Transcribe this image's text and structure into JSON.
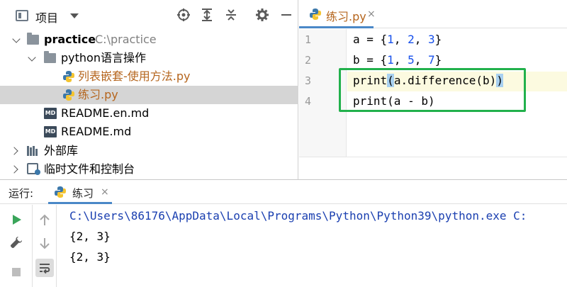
{
  "project_panel": {
    "title": "项目",
    "tree": [
      {
        "label": "practice",
        "hint": "C:\\practice"
      },
      {
        "label": "python语言操作"
      },
      {
        "label": "列表嵌套-使用方法.py"
      },
      {
        "label": "练习.py"
      },
      {
        "label": "README.en.md",
        "icon_text": "MD"
      },
      {
        "label": "README.md",
        "icon_text": "MD"
      },
      {
        "label": "外部库"
      },
      {
        "label": "临时文件和控制台"
      }
    ]
  },
  "editor": {
    "tab_label": "练习.py",
    "tab_close": "×",
    "line_numbers": [
      "1",
      "2",
      "3",
      "4"
    ],
    "code": {
      "line1": {
        "a": "a = {",
        "n1": "1",
        "s1": ", ",
        "n2": "2",
        "s2": ", ",
        "n3": "3",
        "end": "}"
      },
      "line2": {
        "a": "b = {",
        "n1": "1",
        "s1": ", ",
        "n2": "5",
        "s2": ", ",
        "n3": "7",
        "end": "}"
      },
      "line3": {
        "fn": "print",
        "open": "(",
        "body": "a.difference(b)",
        "close": ")"
      },
      "line4": {
        "text": "print(a - b)"
      }
    },
    "highlight_color": "#22b14c"
  },
  "run_panel": {
    "label": "运行:",
    "tab_label": "练习",
    "tab_close": "×",
    "console": [
      "C:\\Users\\86176\\AppData\\Local\\Programs\\Python\\Python39\\python.exe C:",
      "{2, 3}",
      "{2, 3}"
    ]
  },
  "colors": {
    "accent_tab": "#4a88c7",
    "number": "#1750eb",
    "python_file": "#b5651d"
  }
}
